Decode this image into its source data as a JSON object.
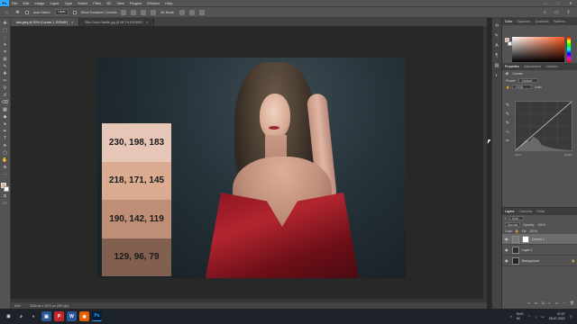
{
  "app": {
    "logo": "Ps"
  },
  "menu": [
    "File",
    "Edit",
    "Image",
    "Layer",
    "Type",
    "Select",
    "Filter",
    "3D",
    "View",
    "Plugins",
    "Window",
    "Help"
  ],
  "options_bar": {
    "auto_select": "Auto-Select:",
    "auto_select_value": "Layer",
    "show_transform": "Show Transform Controls",
    "mode_3d": "3D Mode:"
  },
  "tabs": [
    {
      "label": "abb.jpeg @ 50% (Curves 1, RGB/8*)",
      "close": "×",
      "active": true
    },
    {
      "label": "Skin Color Palette.jpg @ 66.7% (RGB/8*)",
      "close": "×",
      "active": false
    }
  ],
  "swatches": [
    {
      "label": "230, 198, 183",
      "color": "#e6c6b7"
    },
    {
      "label": "218, 171, 145",
      "color": "#daab91"
    },
    {
      "label": "190, 142, 119",
      "color": "#be8e77"
    },
    {
      "label": "129, 96, 79",
      "color": "#81604f"
    }
  ],
  "status": {
    "zoom": "50%",
    "doc": "3200 px x 1474 px (300 ppi)"
  },
  "color_panel": {
    "tabs": [
      "Color",
      "Swatches",
      "Gradients",
      "Patterns"
    ]
  },
  "properties_panel": {
    "tabs": [
      "Properties",
      "Adjustments",
      "Libraries"
    ],
    "header": "Curves",
    "preset_label": "Preset:",
    "preset_value": "Default",
    "channel_value": "RGB",
    "auto_label": "Auto",
    "input_label": "Input",
    "output_label": "Output"
  },
  "layers_panel": {
    "tabs": [
      "Layers",
      "Channels",
      "Paths"
    ],
    "kind_value": "Kind",
    "blend_value": "Normal",
    "opacity_label": "Opacity:",
    "opacity_value": "100%",
    "lock_label": "Lock:",
    "fill_label": "Fill:",
    "fill_value": "100%",
    "layers": [
      {
        "name": "Curves 1",
        "active": true
      },
      {
        "name": "Layer 1",
        "active": false
      },
      {
        "name": "Background",
        "active": false
      }
    ]
  },
  "taskbar": {
    "apps": [
      {
        "label": "⊞",
        "color": "#1e2229"
      },
      {
        "label": "⌕",
        "color": "#1e2229"
      },
      {
        "label": "◐",
        "color": "#1e2229"
      },
      {
        "label": "▣",
        "color": "#2b5797"
      },
      {
        "label": "P",
        "color": "#c4262e"
      },
      {
        "label": "W",
        "color": "#2b579a"
      },
      {
        "label": "◉",
        "color": "#e66000"
      },
      {
        "label": "Ps",
        "color": "#001e36"
      }
    ],
    "lang": "ENG",
    "region": "IN",
    "time": "07:07",
    "date": "28-07-2022"
  }
}
